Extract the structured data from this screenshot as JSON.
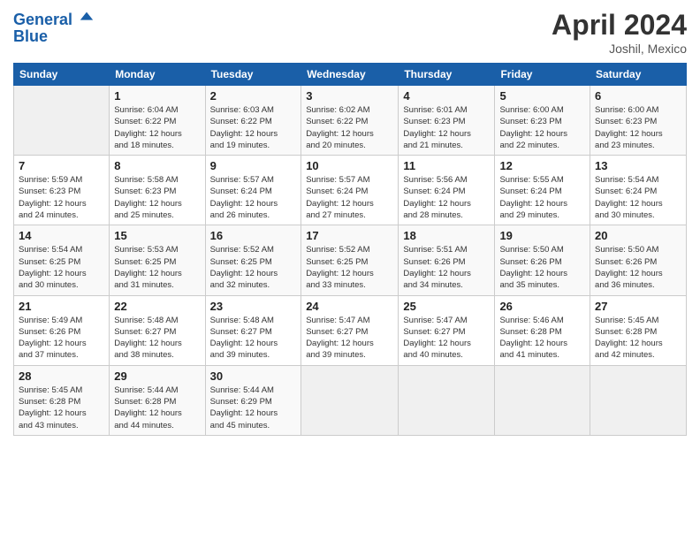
{
  "header": {
    "logo_line1": "General",
    "logo_line2": "Blue",
    "month": "April 2024",
    "location": "Joshil, Mexico"
  },
  "days_of_week": [
    "Sunday",
    "Monday",
    "Tuesday",
    "Wednesday",
    "Thursday",
    "Friday",
    "Saturday"
  ],
  "weeks": [
    [
      {
        "day": "",
        "sunrise": "",
        "sunset": "",
        "daylight": ""
      },
      {
        "day": "1",
        "sunrise": "Sunrise: 6:04 AM",
        "sunset": "Sunset: 6:22 PM",
        "daylight": "Daylight: 12 hours and 18 minutes."
      },
      {
        "day": "2",
        "sunrise": "Sunrise: 6:03 AM",
        "sunset": "Sunset: 6:22 PM",
        "daylight": "Daylight: 12 hours and 19 minutes."
      },
      {
        "day": "3",
        "sunrise": "Sunrise: 6:02 AM",
        "sunset": "Sunset: 6:22 PM",
        "daylight": "Daylight: 12 hours and 20 minutes."
      },
      {
        "day": "4",
        "sunrise": "Sunrise: 6:01 AM",
        "sunset": "Sunset: 6:23 PM",
        "daylight": "Daylight: 12 hours and 21 minutes."
      },
      {
        "day": "5",
        "sunrise": "Sunrise: 6:00 AM",
        "sunset": "Sunset: 6:23 PM",
        "daylight": "Daylight: 12 hours and 22 minutes."
      },
      {
        "day": "6",
        "sunrise": "Sunrise: 6:00 AM",
        "sunset": "Sunset: 6:23 PM",
        "daylight": "Daylight: 12 hours and 23 minutes."
      }
    ],
    [
      {
        "day": "7",
        "sunrise": "Sunrise: 5:59 AM",
        "sunset": "Sunset: 6:23 PM",
        "daylight": "Daylight: 12 hours and 24 minutes."
      },
      {
        "day": "8",
        "sunrise": "Sunrise: 5:58 AM",
        "sunset": "Sunset: 6:23 PM",
        "daylight": "Daylight: 12 hours and 25 minutes."
      },
      {
        "day": "9",
        "sunrise": "Sunrise: 5:57 AM",
        "sunset": "Sunset: 6:24 PM",
        "daylight": "Daylight: 12 hours and 26 minutes."
      },
      {
        "day": "10",
        "sunrise": "Sunrise: 5:57 AM",
        "sunset": "Sunset: 6:24 PM",
        "daylight": "Daylight: 12 hours and 27 minutes."
      },
      {
        "day": "11",
        "sunrise": "Sunrise: 5:56 AM",
        "sunset": "Sunset: 6:24 PM",
        "daylight": "Daylight: 12 hours and 28 minutes."
      },
      {
        "day": "12",
        "sunrise": "Sunrise: 5:55 AM",
        "sunset": "Sunset: 6:24 PM",
        "daylight": "Daylight: 12 hours and 29 minutes."
      },
      {
        "day": "13",
        "sunrise": "Sunrise: 5:54 AM",
        "sunset": "Sunset: 6:24 PM",
        "daylight": "Daylight: 12 hours and 30 minutes."
      }
    ],
    [
      {
        "day": "14",
        "sunrise": "Sunrise: 5:54 AM",
        "sunset": "Sunset: 6:25 PM",
        "daylight": "Daylight: 12 hours and 30 minutes."
      },
      {
        "day": "15",
        "sunrise": "Sunrise: 5:53 AM",
        "sunset": "Sunset: 6:25 PM",
        "daylight": "Daylight: 12 hours and 31 minutes."
      },
      {
        "day": "16",
        "sunrise": "Sunrise: 5:52 AM",
        "sunset": "Sunset: 6:25 PM",
        "daylight": "Daylight: 12 hours and 32 minutes."
      },
      {
        "day": "17",
        "sunrise": "Sunrise: 5:52 AM",
        "sunset": "Sunset: 6:25 PM",
        "daylight": "Daylight: 12 hours and 33 minutes."
      },
      {
        "day": "18",
        "sunrise": "Sunrise: 5:51 AM",
        "sunset": "Sunset: 6:26 PM",
        "daylight": "Daylight: 12 hours and 34 minutes."
      },
      {
        "day": "19",
        "sunrise": "Sunrise: 5:50 AM",
        "sunset": "Sunset: 6:26 PM",
        "daylight": "Daylight: 12 hours and 35 minutes."
      },
      {
        "day": "20",
        "sunrise": "Sunrise: 5:50 AM",
        "sunset": "Sunset: 6:26 PM",
        "daylight": "Daylight: 12 hours and 36 minutes."
      }
    ],
    [
      {
        "day": "21",
        "sunrise": "Sunrise: 5:49 AM",
        "sunset": "Sunset: 6:26 PM",
        "daylight": "Daylight: 12 hours and 37 minutes."
      },
      {
        "day": "22",
        "sunrise": "Sunrise: 5:48 AM",
        "sunset": "Sunset: 6:27 PM",
        "daylight": "Daylight: 12 hours and 38 minutes."
      },
      {
        "day": "23",
        "sunrise": "Sunrise: 5:48 AM",
        "sunset": "Sunset: 6:27 PM",
        "daylight": "Daylight: 12 hours and 39 minutes."
      },
      {
        "day": "24",
        "sunrise": "Sunrise: 5:47 AM",
        "sunset": "Sunset: 6:27 PM",
        "daylight": "Daylight: 12 hours and 39 minutes."
      },
      {
        "day": "25",
        "sunrise": "Sunrise: 5:47 AM",
        "sunset": "Sunset: 6:27 PM",
        "daylight": "Daylight: 12 hours and 40 minutes."
      },
      {
        "day": "26",
        "sunrise": "Sunrise: 5:46 AM",
        "sunset": "Sunset: 6:28 PM",
        "daylight": "Daylight: 12 hours and 41 minutes."
      },
      {
        "day": "27",
        "sunrise": "Sunrise: 5:45 AM",
        "sunset": "Sunset: 6:28 PM",
        "daylight": "Daylight: 12 hours and 42 minutes."
      }
    ],
    [
      {
        "day": "28",
        "sunrise": "Sunrise: 5:45 AM",
        "sunset": "Sunset: 6:28 PM",
        "daylight": "Daylight: 12 hours and 43 minutes."
      },
      {
        "day": "29",
        "sunrise": "Sunrise: 5:44 AM",
        "sunset": "Sunset: 6:28 PM",
        "daylight": "Daylight: 12 hours and 44 minutes."
      },
      {
        "day": "30",
        "sunrise": "Sunrise: 5:44 AM",
        "sunset": "Sunset: 6:29 PM",
        "daylight": "Daylight: 12 hours and 45 minutes."
      },
      {
        "day": "",
        "sunrise": "",
        "sunset": "",
        "daylight": ""
      },
      {
        "day": "",
        "sunrise": "",
        "sunset": "",
        "daylight": ""
      },
      {
        "day": "",
        "sunrise": "",
        "sunset": "",
        "daylight": ""
      },
      {
        "day": "",
        "sunrise": "",
        "sunset": "",
        "daylight": ""
      }
    ]
  ]
}
